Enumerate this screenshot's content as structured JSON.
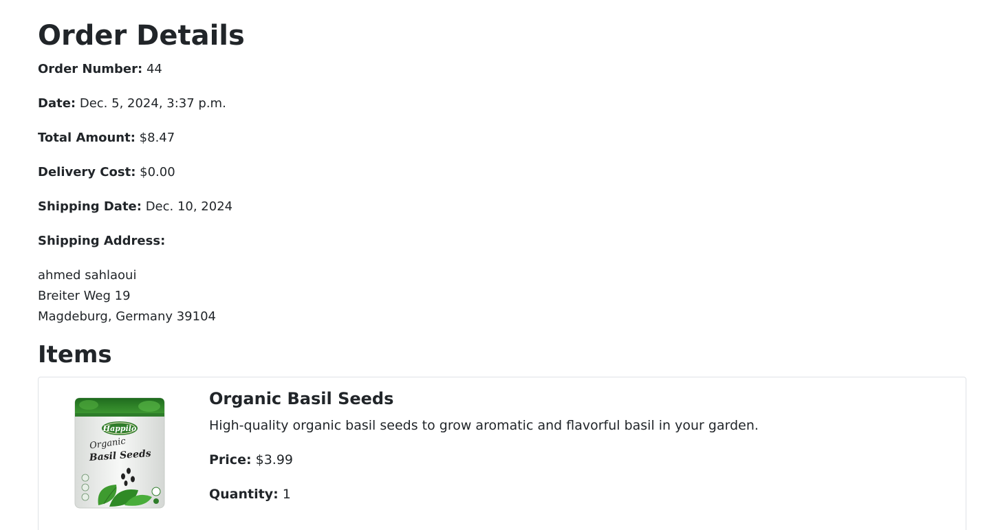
{
  "page": {
    "title": "Order Details"
  },
  "order": {
    "number_label": "Order Number:",
    "number": "44",
    "date_label": "Date:",
    "date": "Dec. 5, 2024, 3:37 p.m.",
    "total_label": "Total Amount:",
    "total": "$8.47",
    "delivery_label": "Delivery Cost:",
    "delivery": "$0.00",
    "shipping_date_label": "Shipping Date:",
    "shipping_date": "Dec. 10, 2024",
    "address_label": "Shipping Address:",
    "address": {
      "name": "ahmed sahlaoui",
      "street": "Breiter Weg 19",
      "city_line": "Magdeburg, Germany 39104"
    }
  },
  "items_section": {
    "title": "Items",
    "items": [
      {
        "name": "Organic Basil Seeds",
        "description": "High-quality organic basil seeds to grow aromatic and flavorful basil in your garden.",
        "price_label": "Price:",
        "price": "$3.99",
        "quantity_label": "Quantity:",
        "quantity": "1",
        "image": {
          "brand": "Happilo",
          "line1": "Organic",
          "line2": "Basil Seeds"
        }
      }
    ]
  }
}
